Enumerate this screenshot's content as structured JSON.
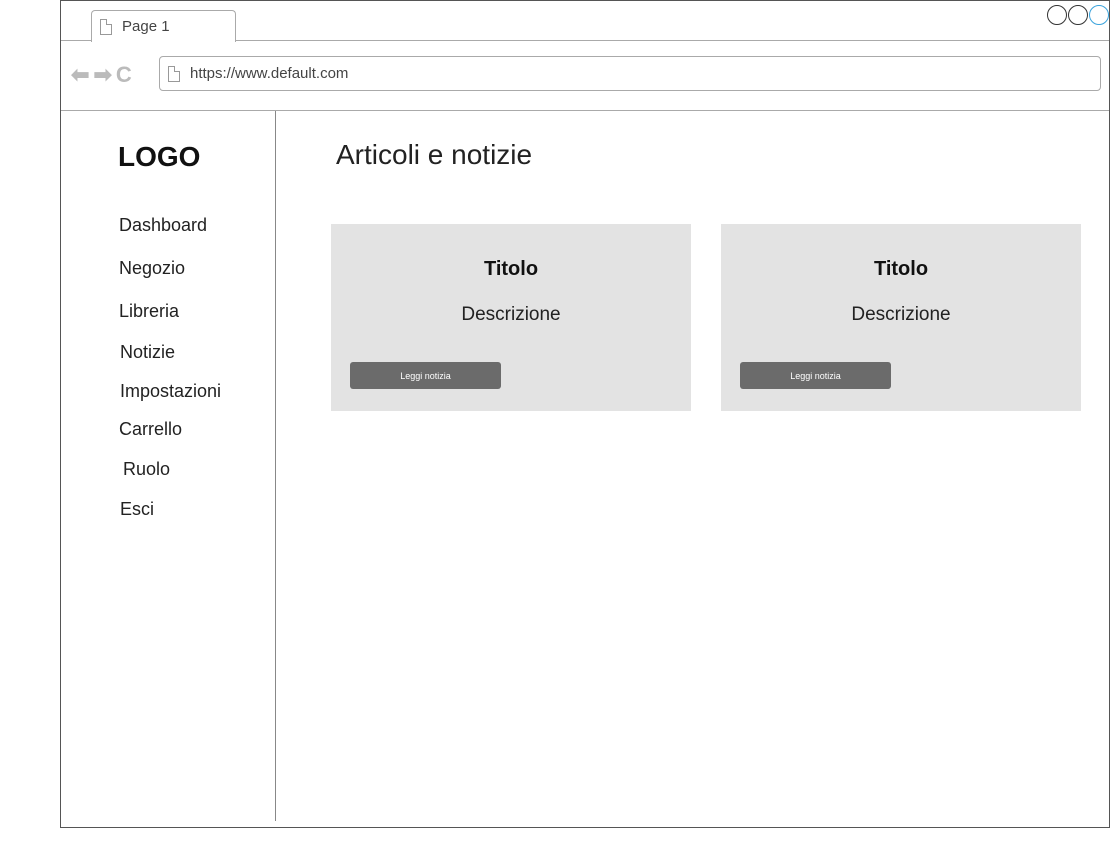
{
  "browser": {
    "tab_title": "Page 1",
    "url": "https://www.default.com"
  },
  "sidebar": {
    "logo": "LOGO",
    "items": [
      {
        "label": "Dashboard"
      },
      {
        "label": "Negozio"
      },
      {
        "label": "Libreria"
      },
      {
        "label": "Notizie"
      },
      {
        "label": "Impostazioni"
      },
      {
        "label": "Carrello"
      },
      {
        "label": "Ruolo"
      },
      {
        "label": "Esci"
      }
    ]
  },
  "main": {
    "title": "Articoli e notizie",
    "cards": [
      {
        "title": "Titolo",
        "description": "Descrizione",
        "button": "Leggi notizia"
      },
      {
        "title": "Titolo",
        "description": "Descrizione",
        "button": "Leggi notizia"
      }
    ]
  },
  "colors": {
    "card_background": "#e3e3e3",
    "button_background": "#6b6b6b",
    "window_active_control": "#3aa3dc"
  }
}
